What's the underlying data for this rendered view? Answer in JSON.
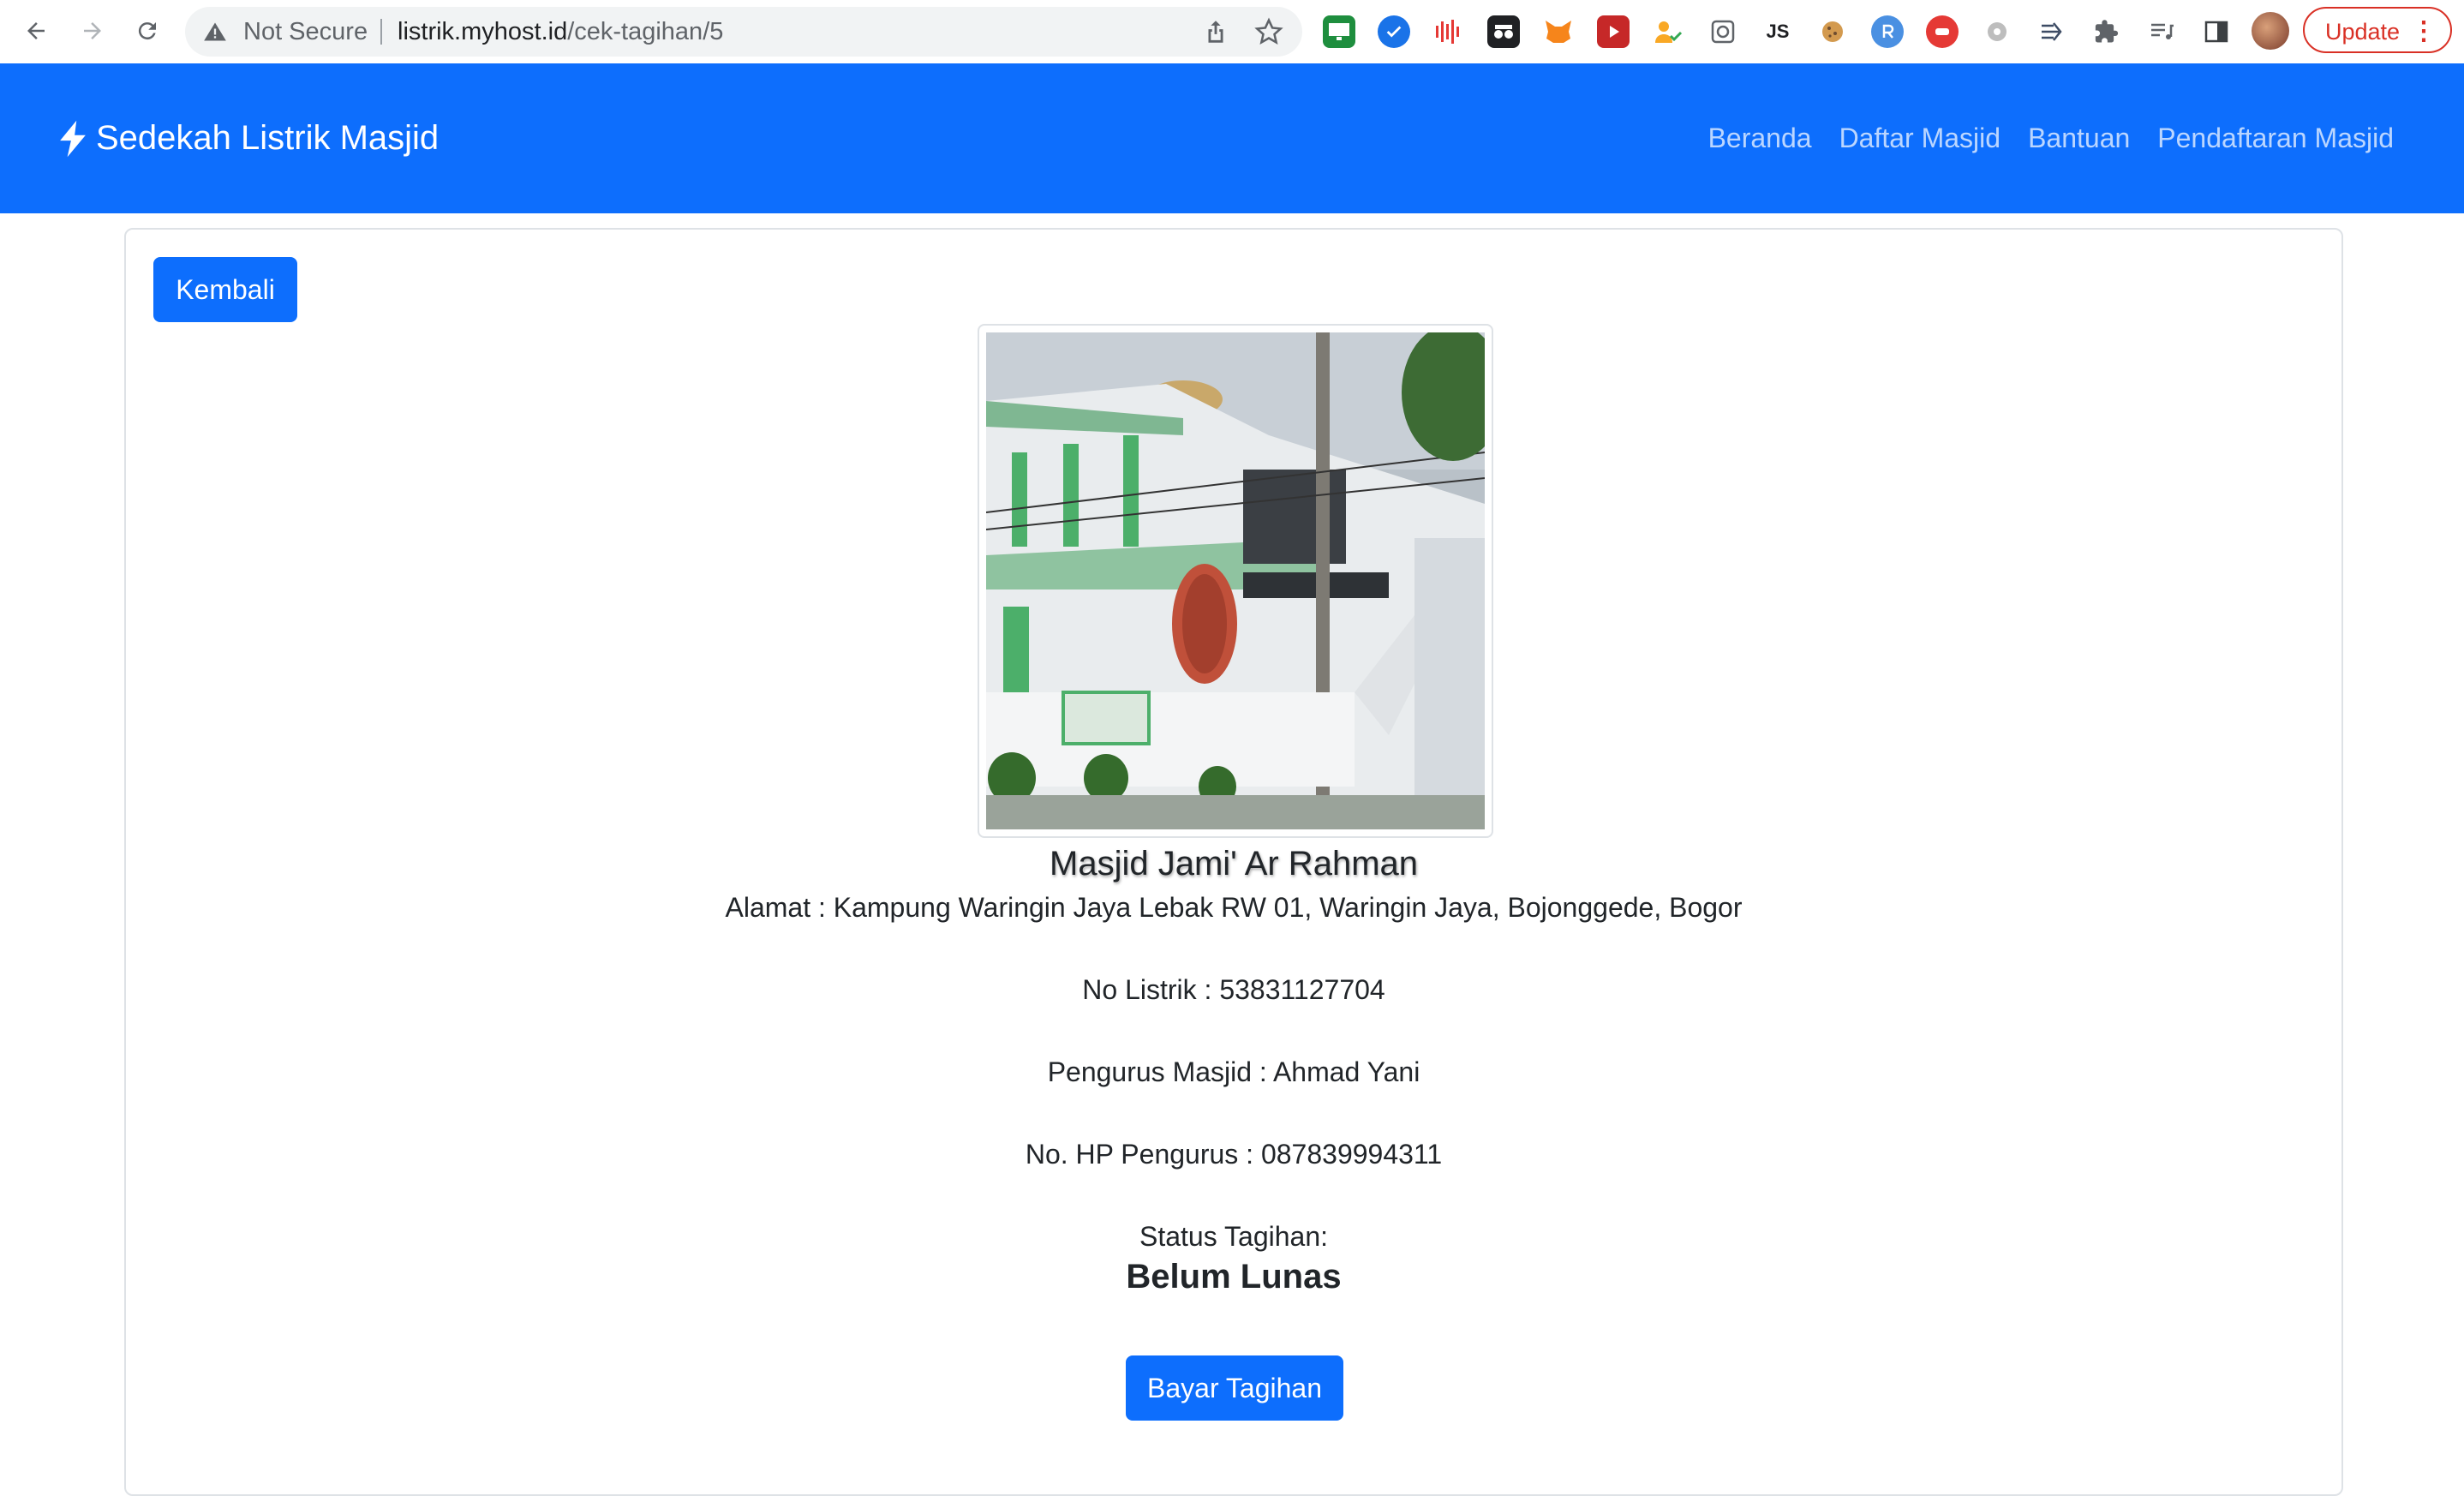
{
  "browser": {
    "security_label": "Not Secure",
    "url_host": "listrik.myhost.id",
    "url_path": "/cek-tagihan/5",
    "extension_js_label": "JS",
    "update_label": "Update"
  },
  "navbar": {
    "brand": "Sedekah Listrik Masjid",
    "links": [
      "Beranda",
      "Daftar Masjid",
      "Bantuan",
      "Pendaftaran Masjid"
    ],
    "color": "#0d6efd"
  },
  "card": {
    "back_label": "Kembali",
    "mosque_name": "Masjid Jami' Ar Rahman",
    "address": "Alamat : Kampung Waringin Jaya Lebak RW 01, Waringin Jaya, Bojonggede, Bogor",
    "meter_number": "No Listrik : 53831127704",
    "caretaker": "Pengurus Masjid : Ahmad Yani",
    "caretaker_phone": "No. HP Pengurus : 087839994311",
    "status_label": "Status Tagihan:",
    "status_value": "Belum Lunas",
    "pay_label": "Bayar Tagihan"
  }
}
